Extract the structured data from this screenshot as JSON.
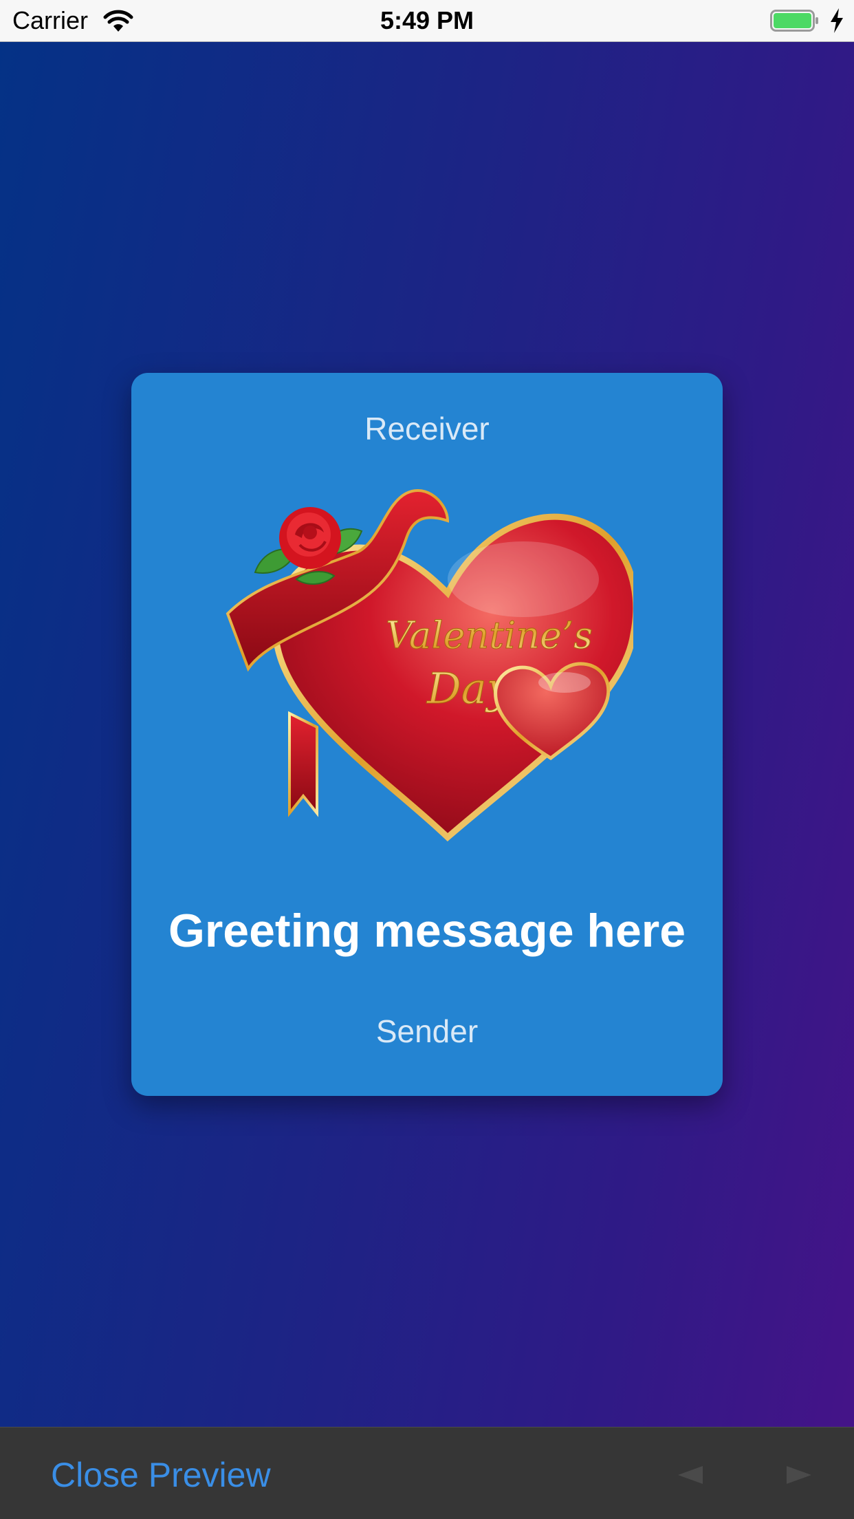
{
  "status_bar": {
    "carrier": "Carrier",
    "time": "5:49 PM",
    "icons": [
      "wifi-icon",
      "battery-icon",
      "charging-bolt-icon"
    ]
  },
  "card": {
    "receiver": "Receiver",
    "image_text": "Valentine's Day",
    "greeting": "Greeting message here",
    "sender": "Sender"
  },
  "toolbar": {
    "close_label": "Close Preview",
    "icons": [
      "previous-arrow-icon",
      "next-arrow-icon"
    ]
  },
  "colors": {
    "background_start": "#043286",
    "background_end": "#461388",
    "card": "#2484d2",
    "toolbar": "#363636",
    "link": "#3a8ee6",
    "battery": "#4cd964"
  }
}
